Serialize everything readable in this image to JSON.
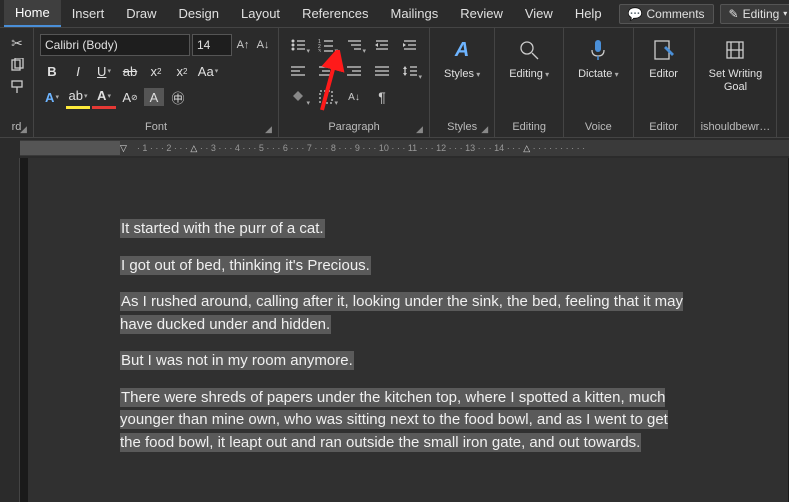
{
  "tabs": {
    "items": [
      "Home",
      "Insert",
      "Draw",
      "Design",
      "Layout",
      "References",
      "Mailings",
      "Review",
      "View",
      "Help"
    ],
    "active": 0,
    "comments": "Comments",
    "editing": "Editing"
  },
  "font": {
    "name": "Calibri (Body)",
    "size": "14"
  },
  "groups": {
    "clipboard": "rd",
    "font": "Font",
    "paragraph": "Paragraph",
    "styles": "Styles",
    "styles2": "Styles",
    "editing": "Editing",
    "voice": "Voice",
    "editor": "Editor",
    "ishould": "ishouldbewr…"
  },
  "big": {
    "styles": "Styles",
    "editing": "Editing",
    "dictate": "Dictate",
    "editor": "Editor",
    "goal": "Set Writing\nGoal"
  },
  "ruler": {
    "marks": [
      "",
      "1",
      "2",
      "",
      "3",
      "4",
      "5",
      "6",
      "7",
      "8",
      "9",
      "10",
      "11",
      "12",
      "13",
      "14",
      "",
      "",
      "",
      "",
      "",
      "",
      "",
      ""
    ]
  },
  "doc": {
    "p1": "It started with the purr of a cat.",
    "p2": "I got out of bed, thinking it's Precious.",
    "p3": "As I rushed around, calling after it, looking under the sink, the bed, feeling that it may have ducked under and hidden.",
    "p4": "But I was not in my room anymore.",
    "p5": "There were shreds of papers under the kitchen top, where I spotted a kitten, much younger than mine own, who was sitting next to the food bowl, and as I went to get the food bowl, it leapt out and ran outside the small iron gate, and out towards."
  }
}
